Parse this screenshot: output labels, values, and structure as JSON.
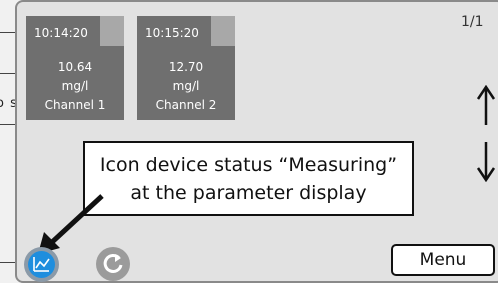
{
  "background": {
    "partial_text": "o s"
  },
  "screen": {
    "page_indicator": "1/1"
  },
  "tiles": [
    {
      "time": "10:14:20",
      "value": "10.64",
      "unit": "mg/l",
      "channel": "Channel 1"
    },
    {
      "time": "10:15:20",
      "value": "12.70",
      "unit": "mg/l",
      "channel": "Channel 2"
    }
  ],
  "callout": {
    "line1": "Icon device status “Measuring”",
    "line2": "at the parameter display"
  },
  "menu": {
    "label": "Menu"
  },
  "icons": {
    "status": "measuring-chart-icon",
    "refresh": "refresh-icon",
    "up": "arrow-up-icon",
    "down": "arrow-down-icon"
  },
  "colors": {
    "screen_bg": "#e2e2e2",
    "tile_bg": "#6f6f6f",
    "status_blue": "#1f8ede"
  }
}
